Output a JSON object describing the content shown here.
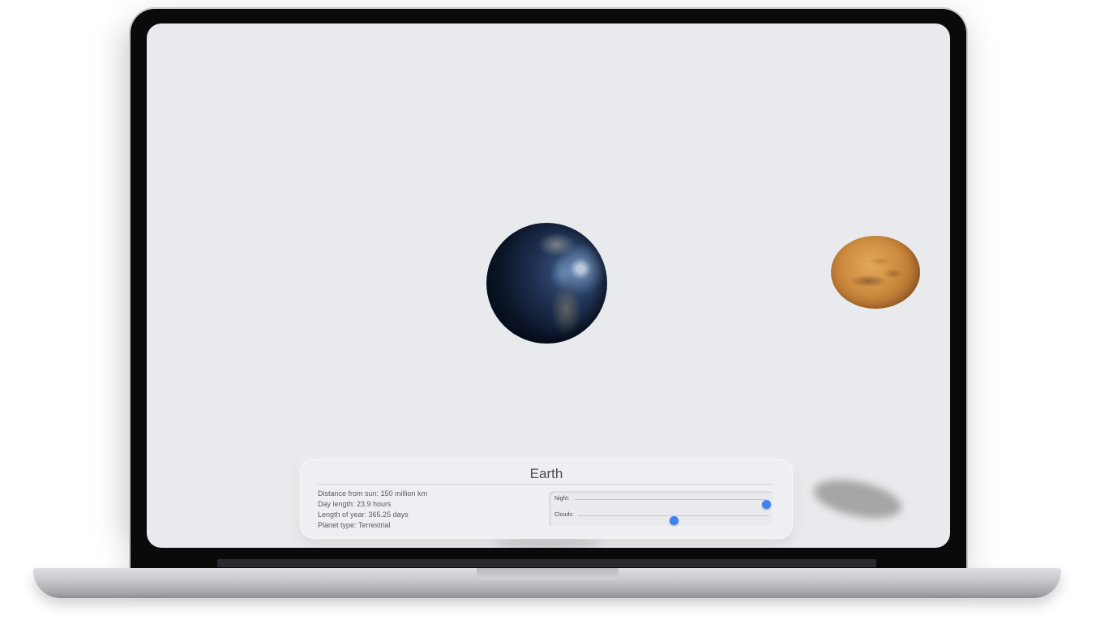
{
  "planet_panel": {
    "title": "Earth",
    "facts": {
      "distance": "Distance from sun: 150 million km",
      "day_length": "Day length: 23.9 hours",
      "year_length": "Length of year: 365.25 days",
      "planet_type": "Planet type: Terrestrial"
    },
    "sliders": {
      "night": {
        "label": "Night:",
        "value": 1.0
      },
      "clouds": {
        "label": "Clouds:",
        "value": 0.5
      }
    }
  },
  "colors": {
    "screen_background": "#e9eaed",
    "slider_thumb": "#3c83f0",
    "panel_background": "#eeeff2"
  },
  "icons": [
    "earth-planet",
    "mars-planet"
  ]
}
